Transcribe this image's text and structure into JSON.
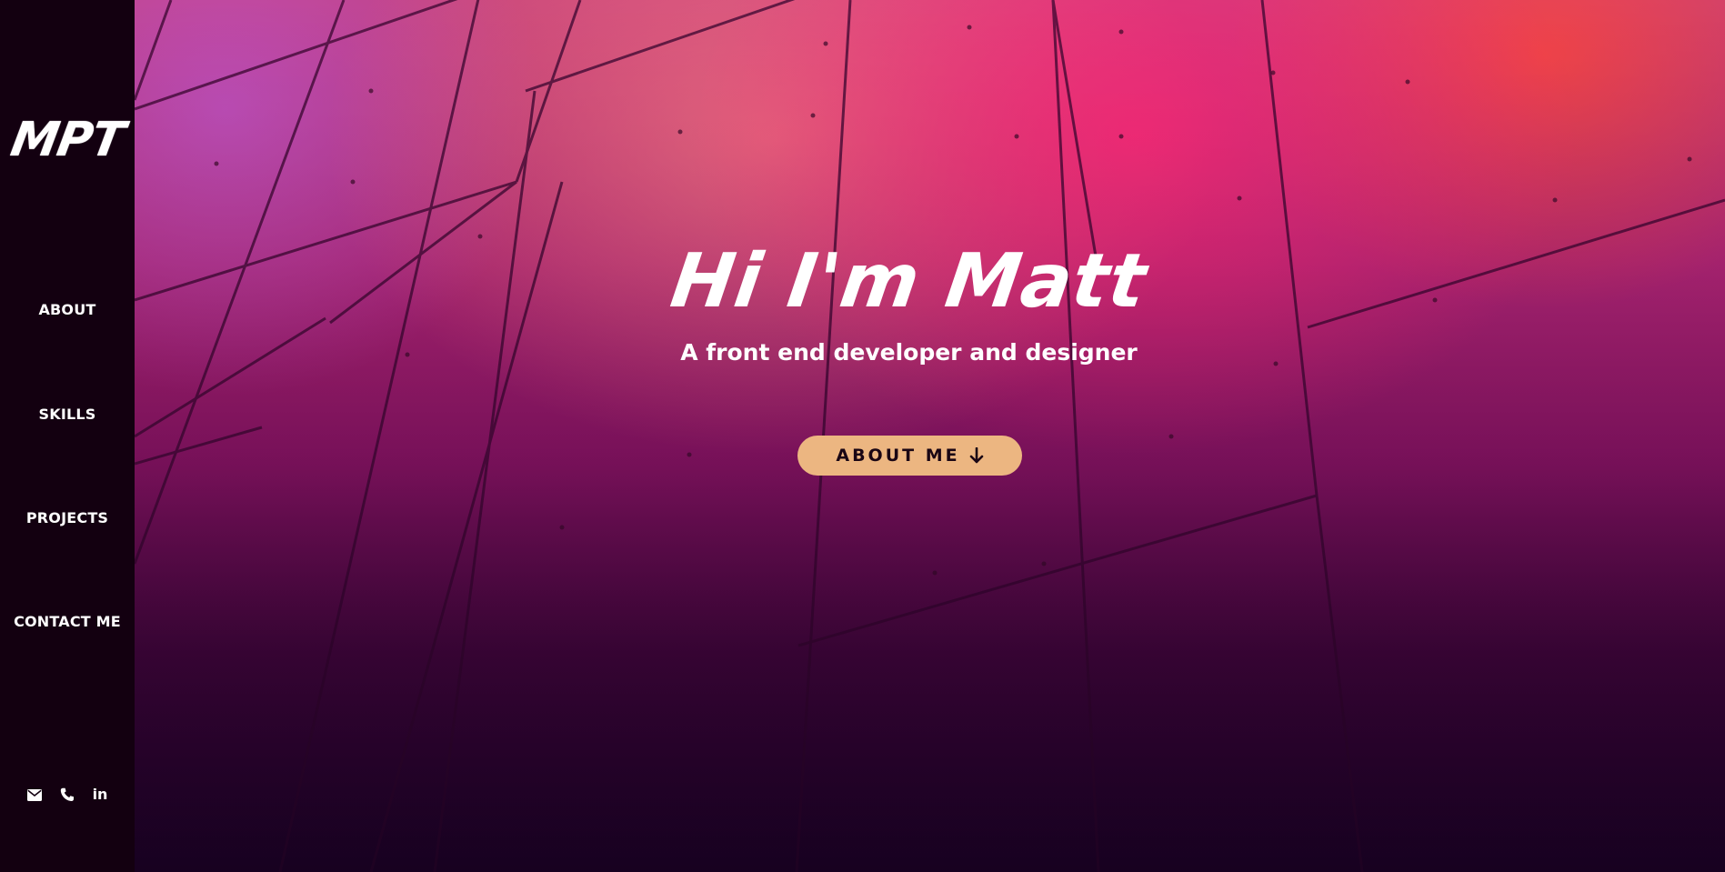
{
  "sidebar": {
    "logo_text": "MPT",
    "nav_items": [
      {
        "label": "ABOUT"
      },
      {
        "label": "SKILLS"
      },
      {
        "label": "PROJECTS"
      },
      {
        "label": "CONTACT ME"
      }
    ],
    "socials": [
      {
        "icon": "envelope-icon"
      },
      {
        "icon": "phone-icon"
      },
      {
        "icon": "linkedin-icon",
        "glyph": "in"
      }
    ]
  },
  "hero": {
    "title": "Hi I'm Matt",
    "subtitle": "A front end developer and designer",
    "cta_label": "ABOUT ME",
    "cta_icon": "arrow-down-icon"
  },
  "colors": {
    "sidebar_bg": "#130010",
    "accent": "#ecb681",
    "text": "#ffffff",
    "hero_top": "#c2407a",
    "hero_bottom": "#22022a"
  }
}
